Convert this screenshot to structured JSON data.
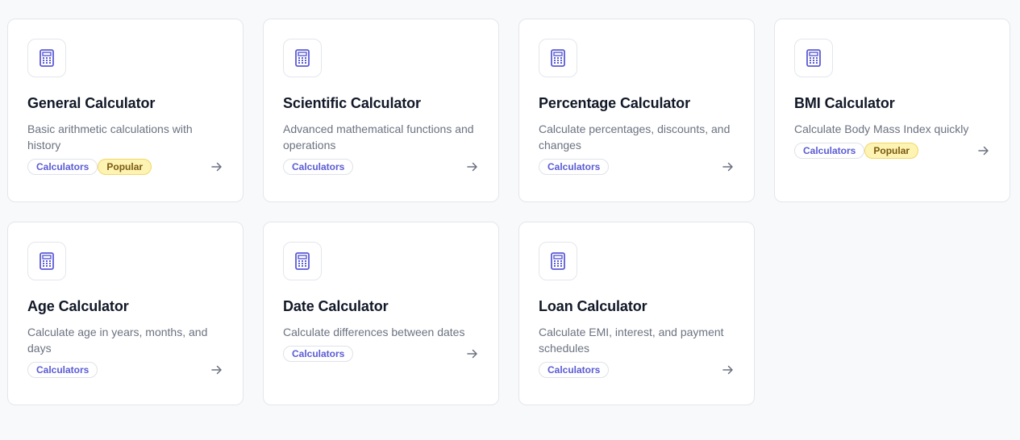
{
  "cards": [
    {
      "title": "General Calculator",
      "description": "Basic arithmetic calculations with history",
      "tags": [
        "Calculators",
        "Popular"
      ]
    },
    {
      "title": "Scientific Calculator",
      "description": "Advanced mathematical functions and operations",
      "tags": [
        "Calculators"
      ]
    },
    {
      "title": "Percentage Calculator",
      "description": "Calculate percentages, discounts, and changes",
      "tags": [
        "Calculators"
      ]
    },
    {
      "title": "BMI Calculator",
      "description": "Calculate Body Mass Index quickly",
      "tags": [
        "Calculators",
        "Popular"
      ]
    },
    {
      "title": "Age Calculator",
      "description": "Calculate age in years, months, and days",
      "tags": [
        "Calculators"
      ]
    },
    {
      "title": "Date Calculator",
      "description": "Calculate differences between dates",
      "tags": [
        "Calculators"
      ]
    },
    {
      "title": "Loan Calculator",
      "description": "Calculate EMI, interest, and payment schedules",
      "tags": [
        "Calculators"
      ]
    }
  ],
  "icons": {
    "card_icon": "calculator-icon",
    "open_icon": "arrow-right-icon"
  },
  "colors": {
    "accent": "#5b5bd6",
    "popular_bg": "#fdf3b3",
    "popular_text": "#7a5a10"
  }
}
